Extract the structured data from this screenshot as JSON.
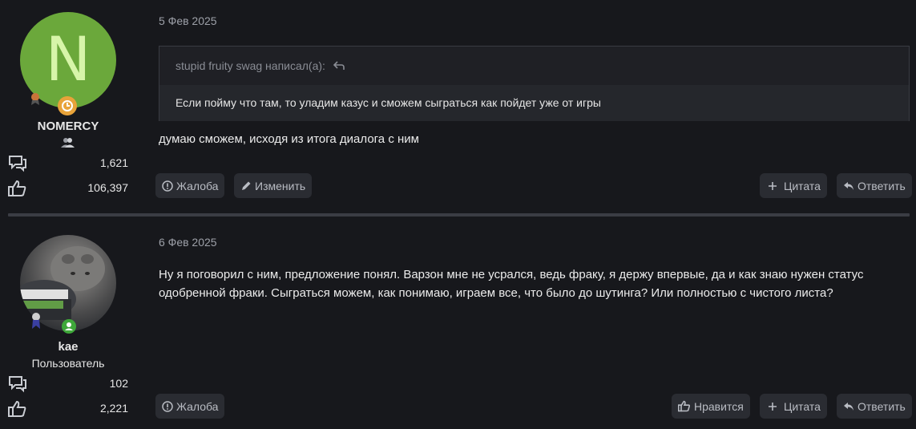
{
  "posts": [
    {
      "avatar_letter": "N",
      "username": "NOMERCY",
      "messages_count": "1,621",
      "reactions_count": "106,397",
      "date": "5 Фев 2025",
      "quote_author": "stupid fruity swag написал(а):",
      "quote_text": "Если пойму что там, то уладим казус и сможем сыграться как пойдет уже от игры",
      "message": "думаю сможем, исходя из итога диалога с ним",
      "buttons": {
        "report": "Жалоба",
        "edit": "Изменить",
        "quote": "Цитата",
        "reply": "Ответить"
      }
    },
    {
      "username": "kae",
      "user_title": "Пользователь",
      "messages_count": "102",
      "reactions_count": "2,221",
      "date": "6 Фев 2025",
      "message": "Ну я поговорил с ним, предложение понял. Варзон мне не усрался, ведь фраку, я держу впервые, да и как знаю нужен статус одобренной фраки. Сыграться можем, как понимаю, играем все, что было до шутинга? Или полностью с чистого листа?",
      "buttons": {
        "report": "Жалоба",
        "like": "Нравится",
        "quote": "Цитата",
        "reply": "Ответить"
      }
    }
  ],
  "colors": {
    "background": "#17181c",
    "avatar_green": "#6ba83b",
    "button_bg": "#2a2c32"
  }
}
